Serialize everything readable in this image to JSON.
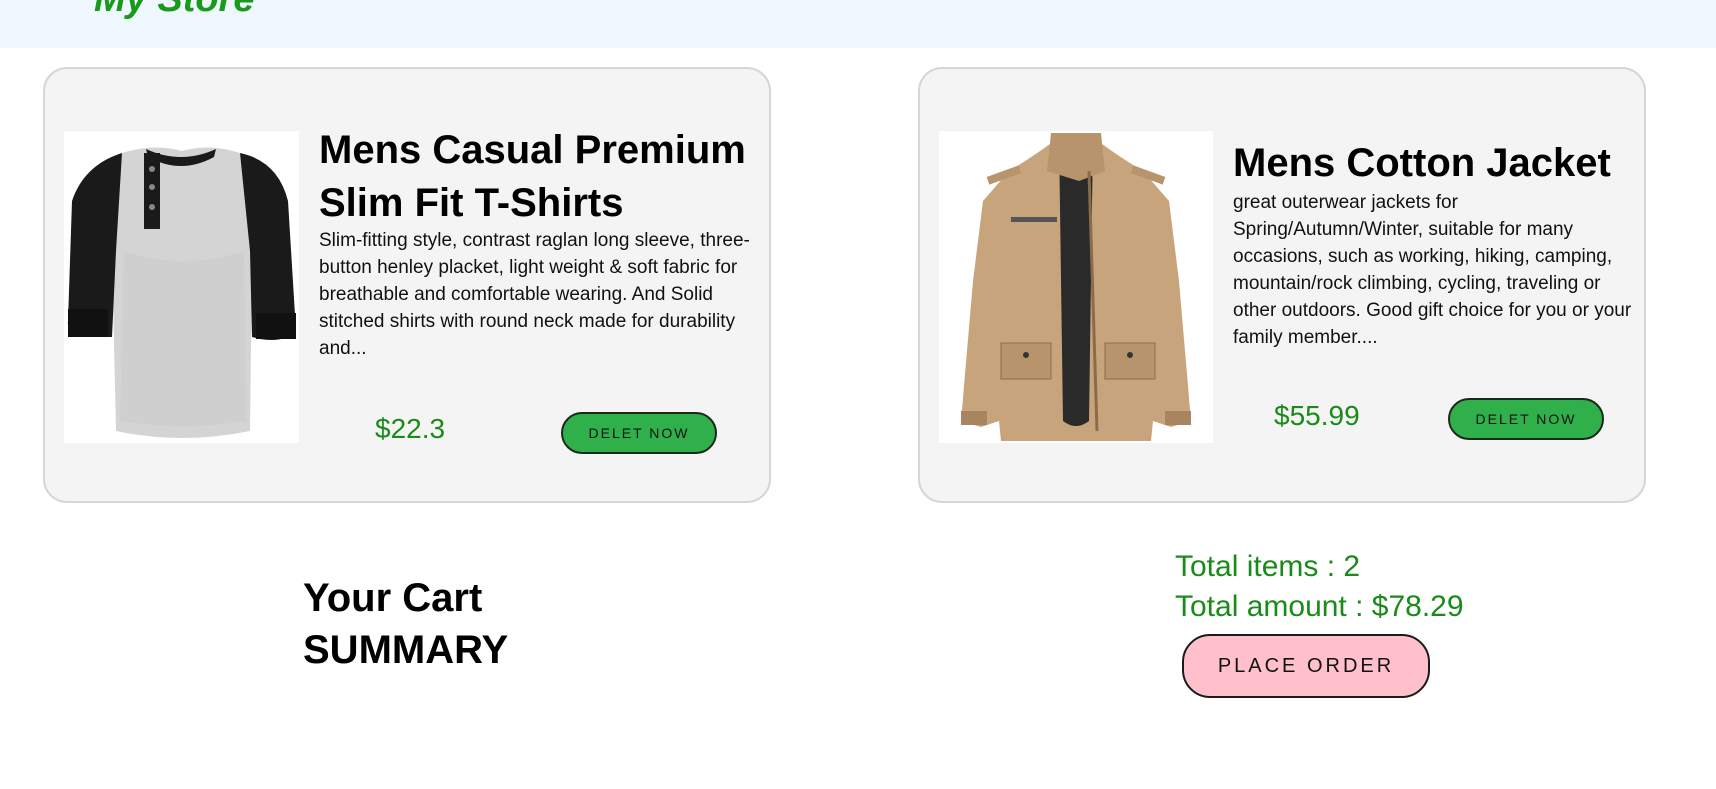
{
  "header": {
    "title": "My Store",
    "title_color": "#1a9a1a",
    "background": "#eff7ff"
  },
  "cart_items": [
    {
      "image_icon": "raglan-henley-shirt-image",
      "title": "Mens Casual Premium Slim Fit T-Shirts",
      "description": "Slim-fitting style, contrast raglan long sleeve, three-button henley placket, light weight & soft fabric for breathable and comfortable wearing. And Solid stitched shirts with round neck made for durability and...",
      "price": "$22.3",
      "button_label": "DELET NOW"
    },
    {
      "image_icon": "cotton-jacket-image",
      "title": "Mens Cotton Jacket",
      "description": "great outerwear jackets for Spring/Autumn/Winter, suitable for many occasions, such as working, hiking, camping, mountain/rock climbing, cycling, traveling or other outdoors. Good gift choice for you or your family member....",
      "price": "$55.99",
      "button_label": "DELET NOW"
    }
  ],
  "summary": {
    "title_line1": "Your Cart",
    "title_line2": "SUMMARY",
    "total_items": "Total items : 2",
    "total_amount": "Total amount : $78.29",
    "place_order_label": "PLACE ORDER"
  },
  "colors": {
    "price": "#1a8a1a",
    "delete_button": "#2fb04a",
    "place_order_button": "#ffc0cb",
    "card_background": "#f4f4f4"
  }
}
